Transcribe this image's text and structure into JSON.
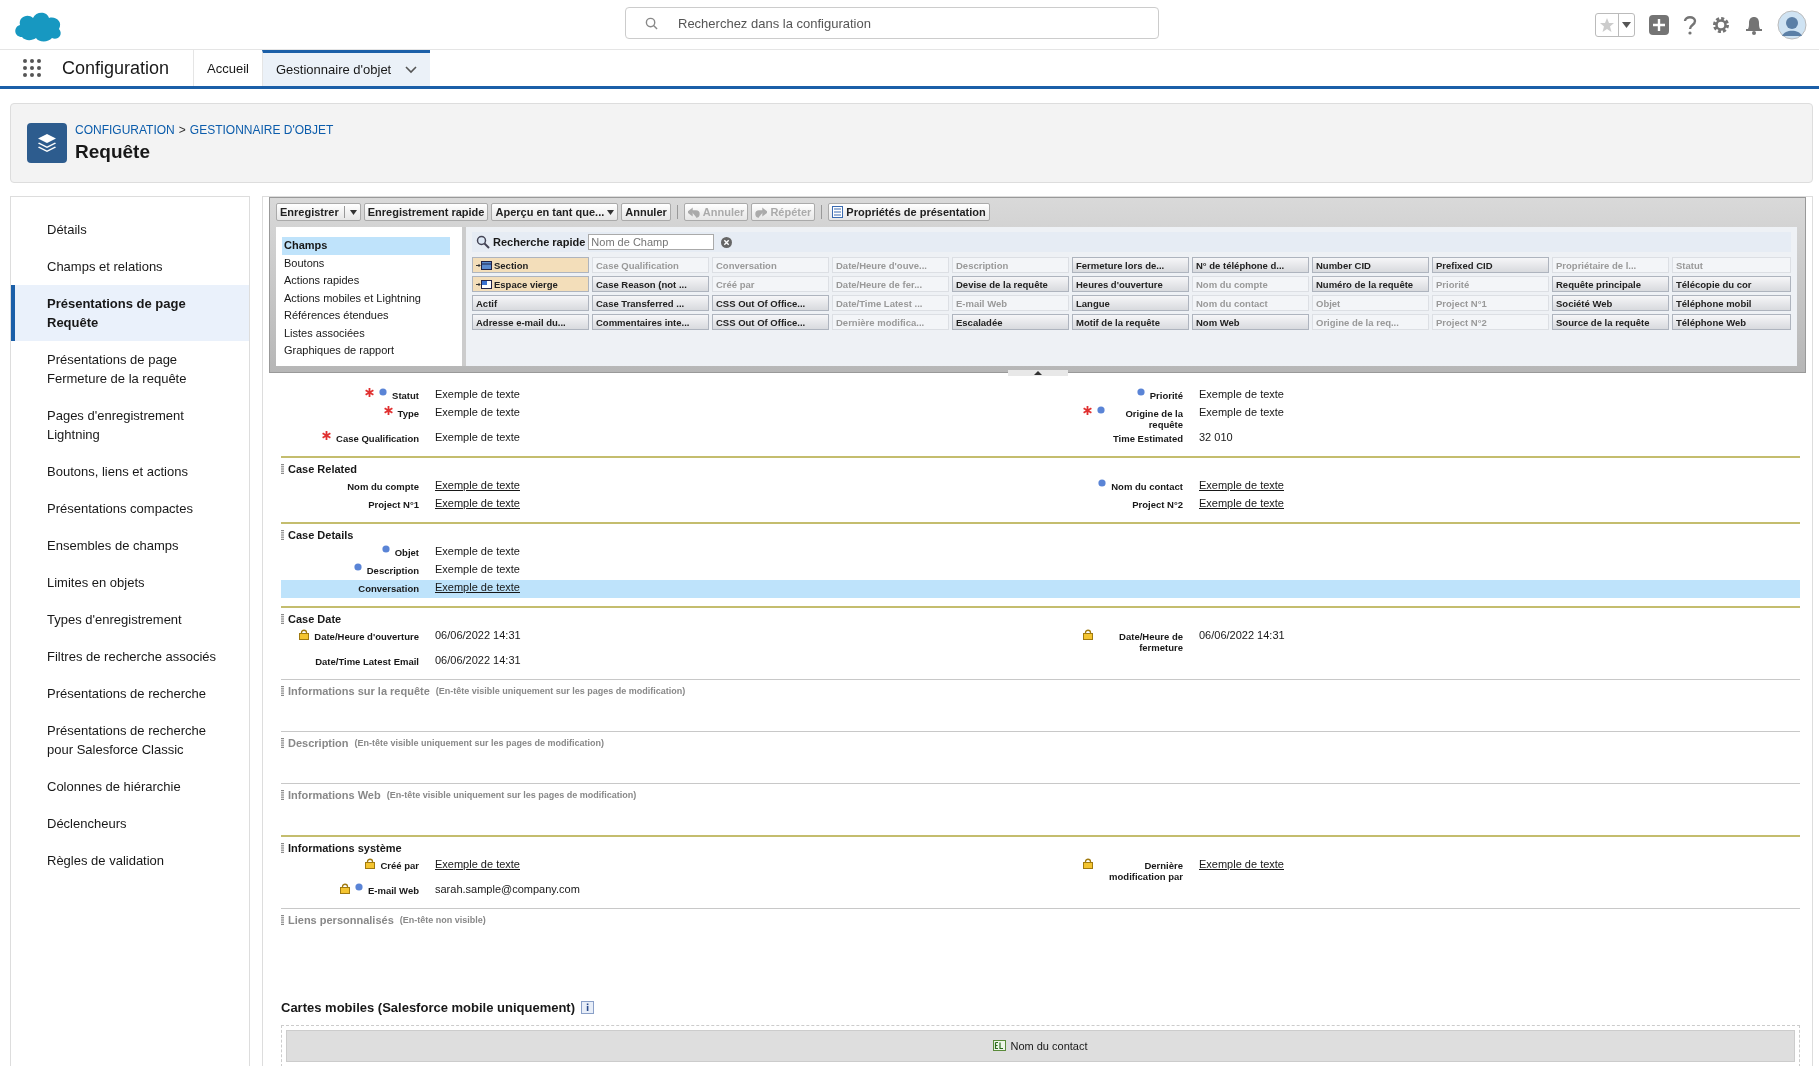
{
  "header": {
    "search": {
      "placeholder": "Recherchez dans la configuration"
    }
  },
  "nav": {
    "app_name": "Configuration",
    "tabs": [
      {
        "label": "Accueil",
        "selected": false,
        "dropdown": false
      },
      {
        "label": "Gestionnaire d'objet",
        "selected": true,
        "dropdown": true
      }
    ]
  },
  "page_header": {
    "breadcrumb": [
      "CONFIGURATION",
      "GESTIONNAIRE D'OBJET"
    ],
    "separator": ">",
    "title": "Requête"
  },
  "sidebar": {
    "items": [
      {
        "label": "Détails",
        "selected": false
      },
      {
        "label": "Champs et relations",
        "selected": false
      },
      {
        "label": "Présentations de page Requête",
        "selected": true
      },
      {
        "label": "Présentations de page Fermeture de la requête",
        "selected": false
      },
      {
        "label": "Pages d'enregistrement Lightning",
        "selected": false
      },
      {
        "label": "Boutons, liens et actions",
        "selected": false
      },
      {
        "label": "Présentations compactes",
        "selected": false
      },
      {
        "label": "Ensembles de champs",
        "selected": false
      },
      {
        "label": "Limites en objets",
        "selected": false
      },
      {
        "label": "Types d'enregistrement",
        "selected": false
      },
      {
        "label": "Filtres de recherche associés",
        "selected": false
      },
      {
        "label": "Présentations de recherche",
        "selected": false
      },
      {
        "label": "Présentations de recherche pour Salesforce Classic",
        "selected": false
      },
      {
        "label": "Colonnes de hiérarchie",
        "selected": false
      },
      {
        "label": "Déclencheurs",
        "selected": false
      },
      {
        "label": "Règles de validation",
        "selected": false
      }
    ]
  },
  "toolbar": {
    "buttons": [
      {
        "label": "Enregistrer",
        "kind": "split",
        "disabled": false
      },
      {
        "label": "Enregistrement rapide",
        "kind": "plain",
        "disabled": false
      },
      {
        "label": "Aperçu en tant que...",
        "kind": "dropdown",
        "disabled": false
      },
      {
        "label": "Annuler",
        "kind": "plain",
        "disabled": false
      },
      {
        "label": "Annuler",
        "kind": "undo",
        "disabled": true
      },
      {
        "label": "Répéter",
        "kind": "redo",
        "disabled": true
      },
      {
        "label": "Propriétés de présentation",
        "kind": "properties",
        "disabled": false
      }
    ]
  },
  "palette": {
    "categories": [
      {
        "label": "Champs",
        "selected": true
      },
      {
        "label": "Boutons",
        "selected": false
      },
      {
        "label": "Actions rapides",
        "selected": false
      },
      {
        "label": "Actions mobiles et Lightning",
        "selected": false
      },
      {
        "label": "Références étendues",
        "selected": false
      },
      {
        "label": "Listes associées",
        "selected": false
      },
      {
        "label": "Graphiques de rapport",
        "selected": false
      }
    ],
    "quick_find": {
      "label": "Recherche rapide",
      "placeholder": "Nom de Champ"
    },
    "items": [
      {
        "label": "Section",
        "kind": "section",
        "used": false
      },
      {
        "label": "Case Qualification",
        "kind": "field",
        "used": true
      },
      {
        "label": "Conversation",
        "kind": "field",
        "used": true
      },
      {
        "label": "Date/Heure d'ouve...",
        "kind": "field",
        "used": true
      },
      {
        "label": "Description",
        "kind": "field",
        "used": true
      },
      {
        "label": "Fermeture lors de...",
        "kind": "field",
        "used": false
      },
      {
        "label": "N° de téléphone d...",
        "kind": "field",
        "used": false
      },
      {
        "label": "Number CID",
        "kind": "field",
        "used": false
      },
      {
        "label": "Prefixed CID",
        "kind": "field",
        "used": false
      },
      {
        "label": "Propriétaire de l...",
        "kind": "field",
        "used": true
      },
      {
        "label": "Statut",
        "kind": "field",
        "used": true
      },
      {
        "label": "Espace vierge",
        "kind": "blank",
        "used": false
      },
      {
        "label": "Case Reason (not ...",
        "kind": "field",
        "used": false
      },
      {
        "label": "Créé par",
        "kind": "field",
        "used": true
      },
      {
        "label": "Date/Heure de fer...",
        "kind": "field",
        "used": true
      },
      {
        "label": "Devise de la requête",
        "kind": "field",
        "used": false
      },
      {
        "label": "Heures d'ouverture",
        "kind": "field",
        "used": false
      },
      {
        "label": "Nom du compte",
        "kind": "field",
        "used": true
      },
      {
        "label": "Numéro de la requête",
        "kind": "field",
        "used": false
      },
      {
        "label": "Priorité",
        "kind": "field",
        "used": true
      },
      {
        "label": "Requête principale",
        "kind": "field",
        "used": false
      },
      {
        "label": "Télécopie du cor",
        "kind": "field",
        "used": false
      },
      {
        "label": "Actif",
        "kind": "field",
        "used": false
      },
      {
        "label": "Case Transferred ...",
        "kind": "field",
        "used": false
      },
      {
        "label": "CSS Out Of Office...",
        "kind": "field",
        "used": false
      },
      {
        "label": "Date/Time Latest ...",
        "kind": "field",
        "used": true
      },
      {
        "label": "E-mail Web",
        "kind": "field",
        "used": true
      },
      {
        "label": "Langue",
        "kind": "field",
        "used": false
      },
      {
        "label": "Nom du contact",
        "kind": "field",
        "used": true
      },
      {
        "label": "Objet",
        "kind": "field",
        "used": true
      },
      {
        "label": "Project N°1",
        "kind": "field",
        "used": true
      },
      {
        "label": "Société Web",
        "kind": "field",
        "used": false
      },
      {
        "label": "Téléphone mobil",
        "kind": "field",
        "used": false
      },
      {
        "label": "Adresse e-mail du...",
        "kind": "field",
        "used": false
      },
      {
        "label": "Commentaires inte...",
        "kind": "field",
        "used": false
      },
      {
        "label": "CSS Out Of Office...",
        "kind": "field",
        "used": false
      },
      {
        "label": "Dernière modifica...",
        "kind": "field",
        "used": true
      },
      {
        "label": "Escaladée",
        "kind": "field",
        "used": false
      },
      {
        "label": "Motif de la requête",
        "kind": "field",
        "used": false
      },
      {
        "label": "Nom Web",
        "kind": "field",
        "used": false
      },
      {
        "label": "Origine de la req...",
        "kind": "field",
        "used": true
      },
      {
        "label": "Project N°2",
        "kind": "field",
        "used": true
      },
      {
        "label": "Source de la requête",
        "kind": "field",
        "used": false
      },
      {
        "label": "Téléphone Web",
        "kind": "field",
        "used": false
      }
    ]
  },
  "layout": {
    "sections": [
      {
        "rows": [
          [
            {
              "label": "Statut",
              "value": "Exemple de texte",
              "link": false,
              "required": true,
              "dot": true,
              "locked": false,
              "selected": false
            },
            {
              "label": "Priorité",
              "value": "Exemple de texte",
              "link": false,
              "required": false,
              "dot": true,
              "locked": false,
              "selected": false
            }
          ],
          [
            {
              "label": "Type",
              "value": "Exemple de texte",
              "link": false,
              "required": true,
              "dot": false,
              "locked": false,
              "selected": false
            },
            {
              "label": "Origine de la requête",
              "value": "Exemple de texte",
              "link": false,
              "required": true,
              "dot": true,
              "locked": false,
              "selected": false
            }
          ],
          [
            {
              "label": "Case Qualification",
              "value": "Exemple de texte",
              "link": false,
              "required": true,
              "dot": false,
              "locked": false,
              "selected": false
            },
            {
              "label": "Time Estimated",
              "value": "32 010",
              "link": false,
              "required": false,
              "dot": false,
              "locked": false,
              "selected": false
            }
          ]
        ]
      },
      {
        "title": "Case Related",
        "hidden": false,
        "rows": [
          [
            {
              "label": "Nom du compte",
              "value": "Exemple de texte",
              "link": true,
              "required": false,
              "dot": false,
              "locked": false,
              "selected": false
            },
            {
              "label": "Nom du contact",
              "value": "Exemple de texte",
              "link": true,
              "required": false,
              "dot": true,
              "locked": false,
              "selected": false
            }
          ],
          [
            {
              "label": "Project N°1",
              "value": "Exemple de texte",
              "link": true,
              "required": false,
              "dot": false,
              "locked": false,
              "selected": false
            },
            {
              "label": "Project N°2",
              "value": "Exemple de texte",
              "link": true,
              "required": false,
              "dot": false,
              "locked": false,
              "selected": false
            }
          ]
        ]
      },
      {
        "title": "Case Details",
        "hidden": false,
        "rows": [
          [
            {
              "label": "Objet",
              "value": "Exemple de texte",
              "link": false,
              "required": false,
              "dot": true,
              "locked": false,
              "selected": false
            },
            null
          ],
          [
            {
              "label": "Description",
              "value": "Exemple de texte",
              "link": false,
              "required": false,
              "dot": true,
              "locked": false,
              "selected": false
            },
            null
          ],
          [
            {
              "label": "Conversation",
              "value": "Exemple de texte",
              "link": true,
              "required": false,
              "dot": false,
              "locked": false,
              "selected": true
            },
            null
          ]
        ]
      },
      {
        "title": "Case Date",
        "hidden": false,
        "rows": [
          [
            {
              "label": "Date/Heure d'ouverture",
              "value": "06/06/2022 14:31",
              "link": false,
              "required": false,
              "dot": false,
              "locked": true,
              "selected": false
            },
            {
              "label": "Date/Heure de fermeture",
              "value": "06/06/2022 14:31",
              "link": false,
              "required": false,
              "dot": false,
              "locked": true,
              "selected": false
            }
          ],
          [
            {
              "label": "Date/Time Latest Email",
              "value": "06/06/2022 14:31",
              "link": false,
              "required": false,
              "dot": false,
              "locked": false,
              "selected": false
            },
            null
          ]
        ]
      },
      {
        "title": "Informations sur la requête",
        "hint": "(En-tête visible uniquement sur les pages de modification)",
        "hidden": true
      },
      {
        "title": "Description",
        "hint": "(En-tête visible uniquement sur les pages de modification)",
        "hidden": true
      },
      {
        "title": "Informations Web",
        "hint": "(En-tête visible uniquement sur les pages de modification)",
        "hidden": true
      },
      {
        "title": "Informations système",
        "hidden": false,
        "rows": [
          [
            {
              "label": "Créé par",
              "value": "Exemple de texte",
              "link": true,
              "required": false,
              "dot": false,
              "locked": true,
              "selected": false
            },
            {
              "label": "Dernière modification par",
              "value": "Exemple de texte",
              "link": true,
              "required": false,
              "dot": false,
              "locked": true,
              "selected": false
            }
          ],
          [
            {
              "label": "E-mail Web",
              "value": "sarah.sample@company.com",
              "link": false,
              "required": false,
              "dot": true,
              "locked": true,
              "selected": false
            },
            null
          ]
        ]
      },
      {
        "title": "Liens personnalisés",
        "hint": "(En-tête non visible)",
        "hidden": true
      }
    ]
  },
  "mobile_cards": {
    "title": "Cartes mobiles (Salesforce mobile uniquement)",
    "cards": [
      {
        "label": "Nom du contact"
      }
    ]
  }
}
